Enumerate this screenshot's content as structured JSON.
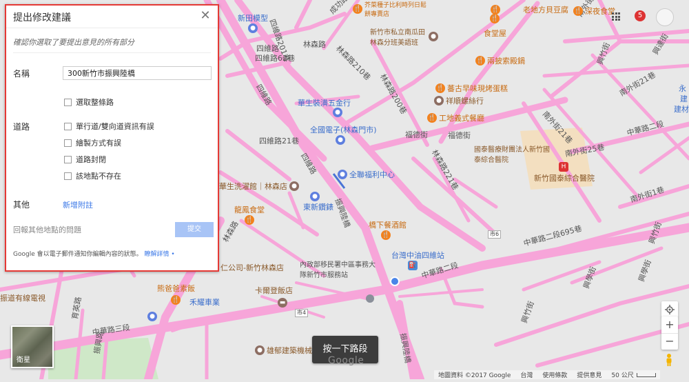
{
  "panel": {
    "title": "提出修改建議",
    "subtitle": "確認你選取了要提出意見的所有部分",
    "name_label": "名稱",
    "name_value": "300新竹市振興陸橋",
    "select_whole_road": "選取整條路",
    "road_label": "道路",
    "road_options": [
      "單行道/雙向道資訊有誤",
      "繪製方式有誤",
      "道路封閉",
      "該地點不存在"
    ],
    "other_label": "其他",
    "add_note": "新增附註",
    "report_other": "回報其他地點的問題",
    "submit": "提交",
    "footer": "Google 會以電子郵件通知你編輯內容的狀態。",
    "learn_more": "瞭解詳情",
    "footer_dot": "•"
  },
  "top_right": {
    "notifications": "5"
  },
  "map_labels": {
    "streets": [
      "四維路201巷",
      "四維路62巷",
      "四維路",
      "四維路21巷",
      "四維路",
      "四維路",
      "林森路210巷",
      "林森路200巷",
      "林森路",
      "林森路",
      "林森路221巷",
      "福德街",
      "福德街",
      "中華路二段",
      "中華路二段",
      "中華路二段695巷",
      "中華路三段",
      "南外街",
      "南外街1巷",
      "南外街25巷",
      "南外街21巷",
      "南外街21巷",
      "興竹街",
      "興竹街",
      "興竹街",
      "興學街",
      "興學街",
      "興達街",
      "成功路",
      "振興陸橋",
      "振興陸橋",
      "振興路",
      "育英路",
      "建"
    ],
    "pois": [
      {
        "name": "新田模型",
        "kind": "shop"
      },
      {
        "name": "芥菜種子比利時列日鬆餅專賣店",
        "kind": "food"
      },
      {
        "name": "老地方貝豆腐",
        "kind": "food"
      },
      {
        "name": "深夜食堂",
        "kind": "food"
      },
      {
        "name": "新竹市私立南瓜田林森分班美語班",
        "kind": "gen"
      },
      {
        "name": "食堂屋",
        "kind": "food"
      },
      {
        "name": "兩披索殿鍋",
        "kind": "food"
      },
      {
        "name": "華生裝潢五金行",
        "kind": "shop"
      },
      {
        "name": "蕃古早味現烤蛋糕",
        "kind": "food"
      },
      {
        "name": "祥順螺絲行",
        "kind": "gen"
      },
      {
        "name": "工地義式餐廳",
        "kind": "food"
      },
      {
        "name": "全國電子(林森門市)",
        "kind": "shop"
      },
      {
        "name": "全聯福利中心",
        "kind": "shop"
      },
      {
        "name": "國泰醫療財團法人新竹國泰綜合醫院",
        "kind": "med"
      },
      {
        "name": "新竹國泰綜合醫院",
        "kind": "med"
      },
      {
        "name": "華生洗濯館｜林森店",
        "kind": "gen"
      },
      {
        "name": "龍鳳食堂",
        "kind": "food"
      },
      {
        "name": "東新鑽錶",
        "kind": "shop"
      },
      {
        "name": "橋下餐酒館",
        "kind": "food"
      },
      {
        "name": "台灣中油四維站",
        "kind": "trans"
      },
      {
        "name": "內政部移民署中區事務大隊新竹市服務站",
        "kind": "gen"
      },
      {
        "name": "仁公司-新竹林森店",
        "kind": "gen"
      },
      {
        "name": "振道有線電視",
        "kind": "gen"
      },
      {
        "name": "熊爸爸素飯",
        "kind": "food"
      },
      {
        "name": "禾耀車業",
        "kind": "shop"
      },
      {
        "name": "卡爾登飯店",
        "kind": "gen"
      },
      {
        "name": "雄郁建築機械行",
        "kind": "gen"
      },
      {
        "name": "永",
        "kind": "gen"
      },
      {
        "name": "建材",
        "kind": "gen"
      }
    ],
    "shields": [
      "市6",
      "市4"
    ]
  },
  "satellite_label": "衛星",
  "next_segment": "按一下路段",
  "google_logo": "Google",
  "attribution": {
    "map_data": "地圖資料 ©2017 Google",
    "region": "台灣",
    "terms": "使用條款",
    "feedback": "提供意見",
    "scale": "50 公尺"
  },
  "colors": {
    "road": "#f7a5d9",
    "map_bg": "#e8e8e8",
    "panel_border": "#e53935",
    "link": "#3b78e7"
  }
}
